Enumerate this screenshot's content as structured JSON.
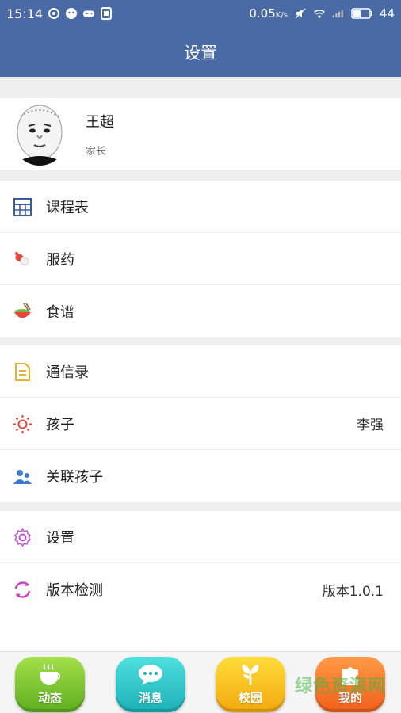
{
  "status_bar": {
    "time": "15:14",
    "data_rate": "0.05",
    "data_unit": "K/s",
    "battery": "44"
  },
  "header": {
    "title": "设置"
  },
  "profile": {
    "name": "王超",
    "role": "家长"
  },
  "groups": [
    {
      "items": [
        {
          "label": "课程表",
          "icon": "calendar-grid-icon"
        },
        {
          "label": "服药",
          "icon": "pill-icon"
        },
        {
          "label": "食谱",
          "icon": "food-bowl-icon"
        }
      ]
    },
    {
      "items": [
        {
          "label": "通信录",
          "icon": "contacts-document-icon"
        },
        {
          "label": "孩子",
          "value": "李强",
          "icon": "sun-icon"
        },
        {
          "label": "关联孩子",
          "icon": "people-icon"
        }
      ]
    },
    {
      "items": [
        {
          "label": "设置",
          "icon": "gear-icon"
        },
        {
          "label": "版本检测",
          "value": "版本1.0.1",
          "icon": "refresh-icon"
        }
      ]
    }
  ],
  "tabs": [
    {
      "label": "动态",
      "icon": "coffee-cup-icon"
    },
    {
      "label": "消息",
      "icon": "chat-bubble-icon"
    },
    {
      "label": "校园",
      "icon": "sprout-icon"
    },
    {
      "label": "我的",
      "icon": "puzzle-icon"
    }
  ],
  "watermark": "绿色资源网",
  "colors": {
    "header": "#4a6aa5",
    "background": "#efefef"
  }
}
